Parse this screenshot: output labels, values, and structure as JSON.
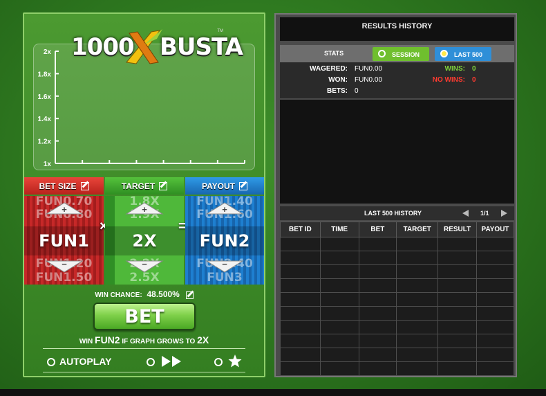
{
  "game": {
    "logo_text_left": "1000",
    "logo_text_right": "BUSTA",
    "logo_tm": "TM",
    "graph": {
      "y_ticks": [
        "2x",
        "1.8x",
        "1.6x",
        "1.4x",
        "1.2x",
        "1x"
      ]
    },
    "columns": {
      "bet_size": {
        "label": "BET SIZE",
        "value": "FUN1",
        "above": [
          "FUN0.70",
          "FUN0.80"
        ],
        "below": [
          "FUN1.20",
          "FUN1.50"
        ]
      },
      "target": {
        "label": "TARGET",
        "value": "2X",
        "above": [
          "1.8X",
          "1.9X"
        ],
        "below": [
          "2.2X",
          "2.5X"
        ]
      },
      "payout": {
        "label": "PAYOUT",
        "value": "FUN2",
        "above": [
          "FUN1.40",
          "FUN1.60"
        ],
        "below": [
          "FUN2.40",
          "FUN3"
        ]
      }
    },
    "operators": {
      "times": "×",
      "equals": "="
    },
    "win_chance_label": "WIN CHANCE:",
    "win_chance_value": "48.500%",
    "bet_label": "BET",
    "win_line": {
      "prefix": "WIN",
      "amount": "FUN2",
      "middle": "IF GRAPH GROWS TO",
      "target": "2X"
    },
    "autoplay_label": "AUTOPLAY"
  },
  "history": {
    "title": "RESULTS HISTORY",
    "stats_label": "STATS",
    "tabs": [
      {
        "label": "SESSION",
        "active": false,
        "color": "#6fbf2e"
      },
      {
        "label": "LAST 500",
        "active": true,
        "color": "#2f8fd8"
      }
    ],
    "stats": {
      "wagered_label": "WAGERED:",
      "wagered_value": "FUN0.00",
      "won_label": "WON:",
      "won_value": "FUN0.00",
      "bets_label": "BETS:",
      "bets_value": "0",
      "wins_label": "WINS:",
      "wins_value": "0",
      "no_wins_label": "NO WINS:",
      "no_wins_value": "0"
    },
    "last_history_label": "LAST 500 HISTORY",
    "page": "1/1",
    "columns": [
      "BET ID",
      "TIME",
      "BET",
      "TARGET",
      "RESULT",
      "PAYOUT"
    ],
    "row_count": 10
  },
  "colors": {
    "bet_size_head": "#d8302a",
    "target_head": "#3fae2e",
    "payout_head": "#1e88d8",
    "wins_label": "#7fd23a",
    "no_wins_label": "#ff3b30",
    "stat_value_green": "#7fd23a",
    "stat_value_red": "#ff3b30"
  }
}
